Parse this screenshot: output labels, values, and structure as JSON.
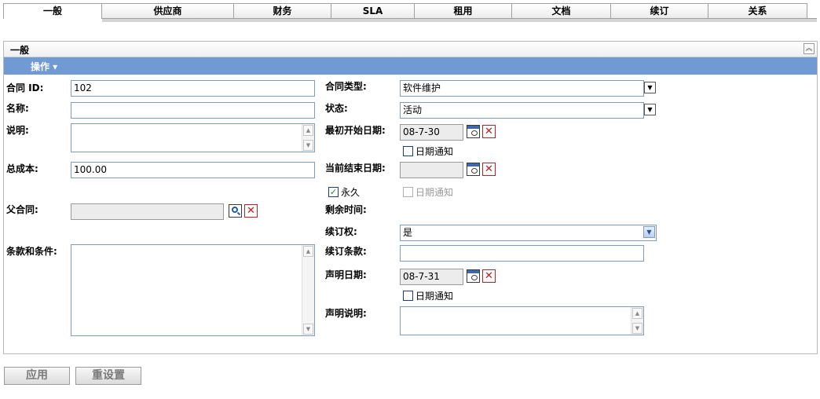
{
  "tabs": [
    {
      "label": "一般",
      "width": 126,
      "active": true
    },
    {
      "label": "供应商",
      "width": 168
    },
    {
      "label": "财务",
      "width": 124
    },
    {
      "label": "SLA",
      "width": 106
    },
    {
      "label": "租用",
      "width": 124
    },
    {
      "label": "文档",
      "width": 126
    },
    {
      "label": "续订",
      "width": 124
    },
    {
      "label": "关系",
      "width": 126
    }
  ],
  "panel": {
    "title": "一般",
    "actions_label": "操作 ▾"
  },
  "form": {
    "contract_id_label": "合同 ID:",
    "contract_id_value": "102",
    "name_label": "名称:",
    "name_value": "",
    "description_label": "说明:",
    "total_cost_label": "总成本:",
    "total_cost_value": "100.00",
    "parent_contract_label": "父合同:",
    "parent_contract_value": "",
    "terms_label": "条款和条件:",
    "contract_type_label": "合同类型:",
    "contract_type_value": "软件维护",
    "status_label": "状态:",
    "status_value": "活动",
    "initial_start_label": "最初开始日期:",
    "initial_start_value": "08-7-30",
    "date_notify_label": "日期通知",
    "current_end_label": "当前结束日期:",
    "current_end_value": "",
    "perpetual_label": "永久",
    "remaining_label": "剩余时间:",
    "renewal_right_label": "续订权:",
    "renewal_right_value": "是",
    "renewal_terms_label": "续订条款:",
    "renewal_terms_value": "",
    "declare_date_label": "声明日期:",
    "declare_date_value": "08-7-31",
    "declare_desc_label": "声明说明:"
  },
  "buttons": {
    "apply": "应用",
    "reset": "重设置"
  }
}
